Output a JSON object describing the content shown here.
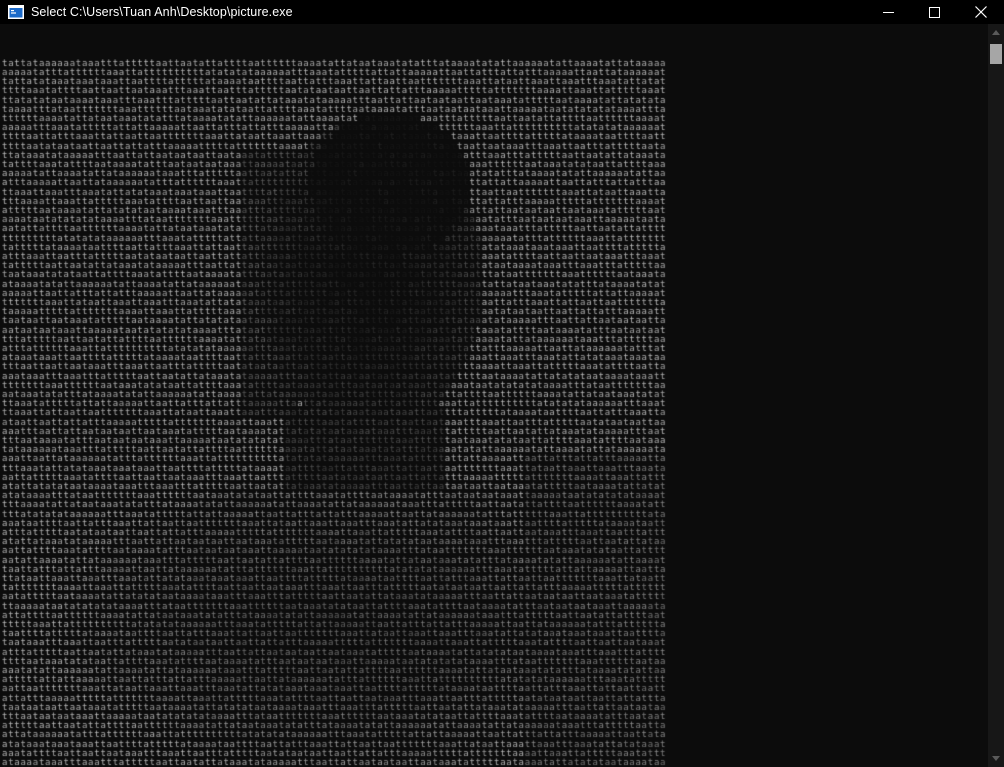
{
  "window": {
    "title": "Select C:\\Users\\Tuan Anh\\Desktop\\picture.exe",
    "icon": "console-app-icon",
    "controls": [
      "minimize-icon",
      "maximize-icon",
      "close-icon"
    ]
  },
  "console": {
    "charset": "at",
    "sample_lines": [
      "tattataaaaaataaatttatttttaattaatattattttaattttttaaaatattataataaatatatttataaaatatattaaaaaatattaaaa",
      "aattataaaaaatatttattttttaaattattttttttttatatatataaaaaatttaaatatttttattattaaaaattaattatttattatttaaaaatt",
      "aaattaaatttaaatattatataaataaataaattaattttatttttataaaataattttaattatttaaattattaattaatttttttaaattataatt",
      "atttttttaaaattaaattatttttaaatattttaattaattaataaatttaaattaatttatttttaatataataattaattattatttaaaaattttt",
      "ataattaataaatatttttaataaaatattatatataataaaataaatttaaatttatttttaattaatattataaatataaaaatttaattattaata",
      "tatttaataataataaattaaaaataatatatatataaaatttataatttttttaaattttttaataaatatataattattttaaatattttaataaaa"
    ],
    "colors": {
      "background": "#0c0c0c",
      "text_bright": "#d2d2d2",
      "text_dark": "#2a2a2a"
    }
  },
  "scrollbar": {
    "up_icon": "scroll-up-arrow-icon",
    "down_icon": "scroll-down-arrow-icon",
    "position": 0
  }
}
